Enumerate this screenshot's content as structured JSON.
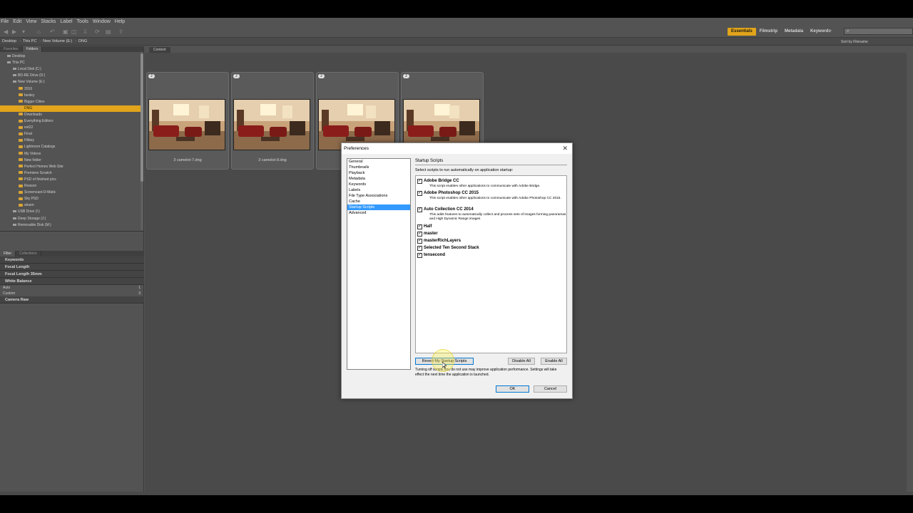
{
  "menubar": {
    "items": [
      "File",
      "Edit",
      "View",
      "Stacks",
      "Label",
      "Tools",
      "Window",
      "Help"
    ]
  },
  "workspaces": [
    "Essentials",
    "Filmstrip",
    "Metadata",
    "Keywords"
  ],
  "search": {
    "placeholder": ""
  },
  "path": [
    "Desktop",
    "This PC",
    "New Volume (E:)",
    "DNG"
  ],
  "sort_label": "Sort by Filename",
  "left_tabs": [
    "Favorites",
    "Folders"
  ],
  "folder_tree": [
    {
      "label": "Desktop",
      "type": "drive",
      "indent": 1
    },
    {
      "label": "This PC",
      "type": "drive",
      "indent": 1
    },
    {
      "label": "Local Disk (C:)",
      "type": "drive",
      "indent": 2
    },
    {
      "label": "BD-RE Drive (D:)",
      "type": "drive",
      "indent": 2
    },
    {
      "label": "New Volume (E:)",
      "type": "drive",
      "indent": 2
    },
    {
      "label": "2016",
      "type": "folder",
      "indent": 3
    },
    {
      "label": "bexley",
      "type": "folder",
      "indent": 3
    },
    {
      "label": "Bigger Cities",
      "type": "folder",
      "indent": 3
    },
    {
      "label": "DNG",
      "type": "folder",
      "indent": 3,
      "selected": true
    },
    {
      "label": "Downloads",
      "type": "folder",
      "indent": 3
    },
    {
      "label": "Everything Editors",
      "type": "folder",
      "indent": 3
    },
    {
      "label": "evt22",
      "type": "folder",
      "indent": 3
    },
    {
      "label": "Final",
      "type": "folder",
      "indent": 3
    },
    {
      "label": "Hillary",
      "type": "folder",
      "indent": 3
    },
    {
      "label": "Lightroom Catalogs",
      "type": "folder",
      "indent": 3
    },
    {
      "label": "My Videos",
      "type": "folder",
      "indent": 3
    },
    {
      "label": "New folder",
      "type": "folder",
      "indent": 3
    },
    {
      "label": "Perfect Homes Web Site",
      "type": "folder",
      "indent": 3
    },
    {
      "label": "Premiere Scratch",
      "type": "folder",
      "indent": 3
    },
    {
      "label": "PSD of finished pics",
      "type": "folder",
      "indent": 3
    },
    {
      "label": "Reason",
      "type": "folder",
      "indent": 3
    },
    {
      "label": "Screencast-O-Matic",
      "type": "folder",
      "indent": 3
    },
    {
      "label": "Sky PSD",
      "type": "folder",
      "indent": 3
    },
    {
      "label": "steam",
      "type": "folder",
      "indent": 3
    },
    {
      "label": "USB Drive (I:)",
      "type": "drive",
      "indent": 2
    },
    {
      "label": "Deep Storage (J:)",
      "type": "drive",
      "indent": 2
    },
    {
      "label": "Removable Disk (M:)",
      "type": "drive",
      "indent": 2
    }
  ],
  "filter_tabs": [
    "Filter",
    "Collections"
  ],
  "filter": {
    "sections": [
      {
        "header": "Keywords",
        "rows": []
      },
      {
        "header": "Focal Length",
        "rows": []
      },
      {
        "header": "Focal Length 35mm",
        "rows": []
      },
      {
        "header": "White Balance",
        "rows": [
          {
            "label": "Auto",
            "count": "1"
          },
          {
            "label": "Custom",
            "count": "3"
          }
        ]
      },
      {
        "header": "Camera Raw",
        "rows": []
      }
    ]
  },
  "content_tab": "Content",
  "thumbnails": [
    {
      "badge": "2",
      "label": "3 camelot-7.dng"
    },
    {
      "badge": "2",
      "label": "3 camelot-9.dng"
    },
    {
      "badge": "2",
      "label": "3 camelot-11.dng"
    },
    {
      "badge": "2",
      "label": "3 camelot-13.dng"
    }
  ],
  "dialog": {
    "title": "Preferences",
    "categories": [
      "General",
      "Thumbnails",
      "Playback",
      "Metadata",
      "Keywords",
      "Labels",
      "File Type Associations",
      "Cache",
      "Startup Scripts",
      "Advanced"
    ],
    "selected_category": 8,
    "section_title": "Startup Scripts",
    "section_desc": "Select scripts to run automatically on application startup:",
    "scripts": [
      {
        "name": "Adobe Bridge CC",
        "desc": "This script enables other applications to communicate with Adobe Bridge.",
        "checked": true
      },
      {
        "name": "Adobe Photoshop CC 2015",
        "desc": "This script enables other applications to communicate with Adobe Photoshop CC 2015.",
        "checked": true
      },
      {
        "name": "Auto Collection CC 2014",
        "desc": "This adds features to automatically collect and process sets of images forming panoramas and High Dynamic Range images",
        "checked": true
      },
      {
        "name": "Half",
        "desc": "",
        "checked": true
      },
      {
        "name": "master",
        "desc": "",
        "checked": true
      },
      {
        "name": "masterRichLayers",
        "desc": "",
        "checked": true
      },
      {
        "name": "Selected Ten Second Stack",
        "desc": "",
        "checked": true
      },
      {
        "name": "tensecond",
        "desc": "",
        "checked": true
      }
    ],
    "revert_label": "Revert My Startup Scripts",
    "disable_label": "Disable All",
    "enable_label": "Enable All",
    "note": "Turning off scripts you do not use may improve application performance. Settings will take effect the next time the application is launched.",
    "ok_label": "OK",
    "cancel_label": "Cancel"
  },
  "colors": {
    "accent": "#e1a41a",
    "selection": "#3399ff",
    "panel": "#535353"
  }
}
